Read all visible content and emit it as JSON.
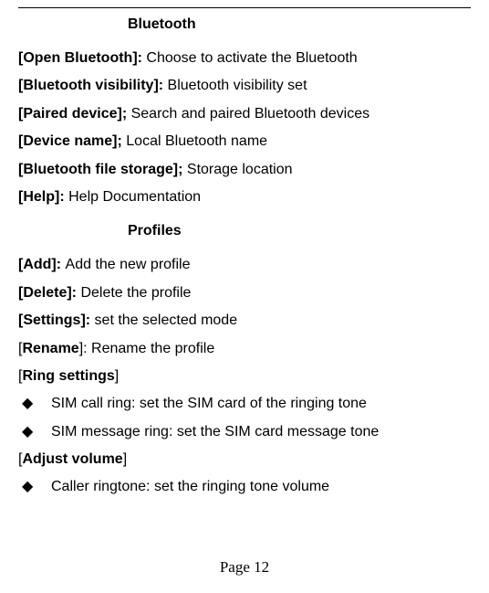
{
  "sections": {
    "bluetooth": {
      "heading": "Bluetooth",
      "items": [
        {
          "label": "[Open Bluetooth]: ",
          "desc": "Choose to activate the Bluetooth"
        },
        {
          "label": "[Bluetooth visibility]: ",
          "desc": "Bluetooth visibility set"
        },
        {
          "label": "[Paired device]; ",
          "desc": "Search and paired Bluetooth devices"
        },
        {
          "label": "[Device name]; ",
          "desc": "Local Bluetooth name"
        },
        {
          "label": "[Bluetooth file storage]; ",
          "desc": "Storage location"
        },
        {
          "label": "[Help]: ",
          "desc": "Help Documentation"
        }
      ]
    },
    "profiles": {
      "heading": "Profiles",
      "items": [
        {
          "label": "[Add]: ",
          "desc": "Add the new profile"
        },
        {
          "label": "[Delete]: ",
          "desc": "Delete the profile"
        },
        {
          "label": "[Settings]: ",
          "desc": "set the selected mode"
        },
        {
          "open": "[",
          "mid": "Rename",
          "close": "]: ",
          "desc": "Rename the profile"
        },
        {
          "open": "[",
          "mid": "Ring settings",
          "close": "]"
        }
      ],
      "ring_bullets": [
        "SIM call ring: set the SIM card of the ringing tone",
        "SIM message ring: set the SIM card message tone"
      ],
      "adjust": {
        "open": "[",
        "mid": "Adjust volume",
        "close": "]"
      },
      "adjust_bullets": [
        "Caller ringtone: set the ringing tone volume"
      ]
    }
  },
  "bullet_glyph": "◆",
  "footer": "Page 12"
}
